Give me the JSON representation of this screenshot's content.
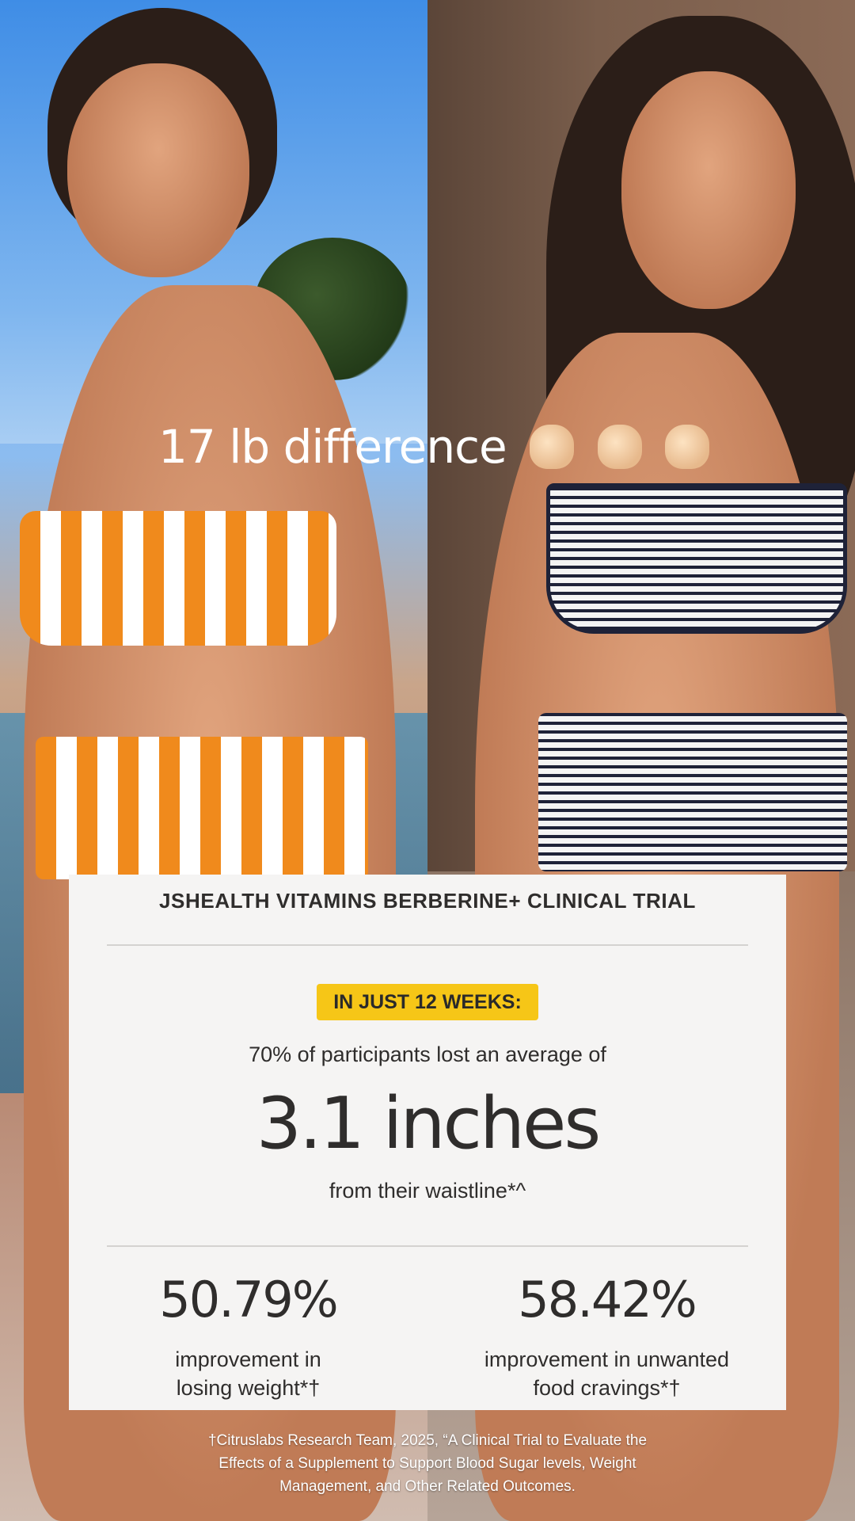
{
  "headline": "17 lb difference",
  "headline_emoji": [
    "clapping-hands-icon",
    "clapping-hands-icon",
    "clapping-hands-icon"
  ],
  "card": {
    "title": "JSHEALTH VITAMINS BERBERINE+ CLINICAL TRIAL",
    "badge": "IN JUST 12 WEEKS:",
    "lead": "70% of participants lost an average of",
    "big_value": "3.1 inches",
    "sub": "from their waistline*^",
    "stats": [
      {
        "value": "50.79%",
        "label_line1": "improvement in",
        "label_line2": "losing weight*†"
      },
      {
        "value": "58.42%",
        "label_line1": "improvement in unwanted",
        "label_line2": "food cravings*†"
      }
    ]
  },
  "footnote": {
    "line1": "†Citruslabs Research Team, 2025, “A Clinical Trial to Evaluate the",
    "line2": "Effects of a Supplement to Support Blood Sugar levels, Weight",
    "line3": "Management, and Other Related Outcomes."
  },
  "colors": {
    "badge": "#f6c617",
    "card_bg": "#f5f4f3",
    "text": "#2f2d2c"
  }
}
